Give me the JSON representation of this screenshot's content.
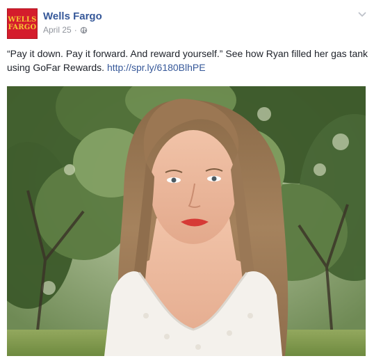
{
  "post": {
    "page_name": "Wells Fargo",
    "date": "April 25",
    "separator": "·",
    "privacy_icon": "globe-icon",
    "menu_icon": "chevron-down-icon",
    "text_main": "“Pay it down. Pay it forward. And reward yourself.” See how Ryan filled her gas tank using GoFar Rewards.",
    "link": "http://spr.ly/6180BlhPE"
  },
  "avatar": {
    "line1": "WELLS",
    "line2": "FARGO"
  },
  "colors": {
    "brand_red": "#d41c2c",
    "brand_gold": "#f6c533",
    "link_blue": "#365899",
    "meta_gray": "#90949c"
  }
}
